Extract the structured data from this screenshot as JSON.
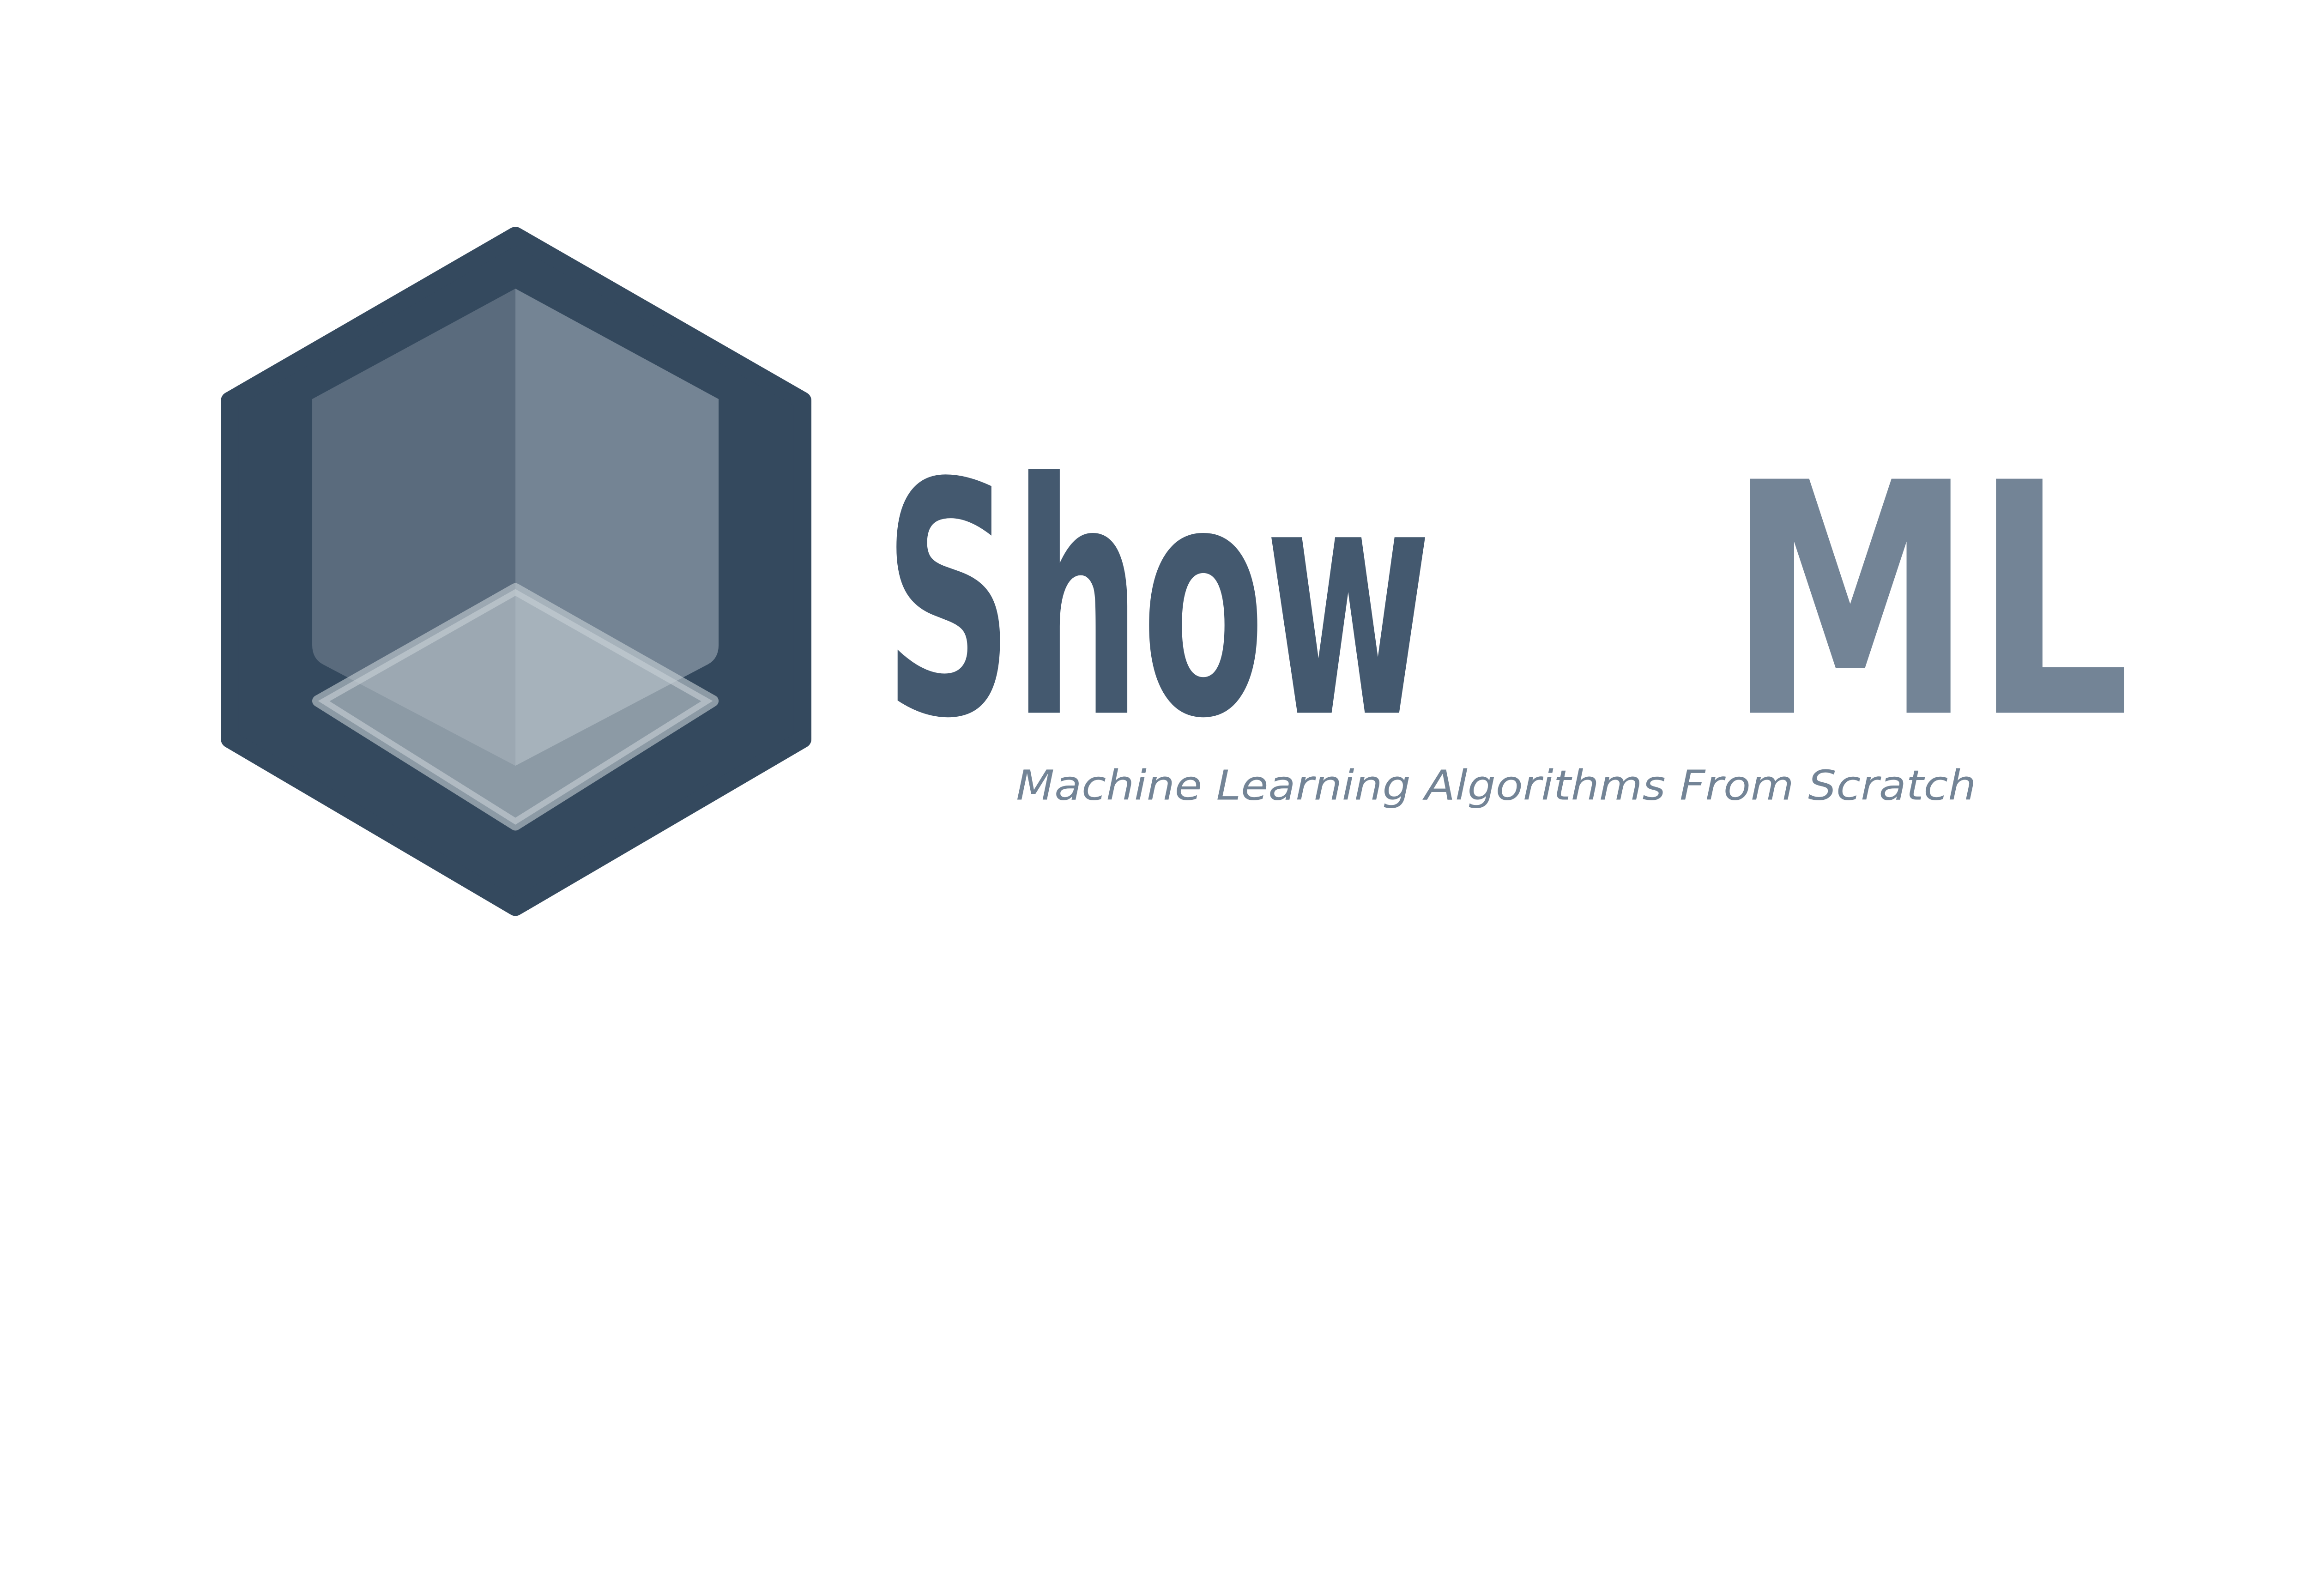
{
  "logo": {
    "name_part1": "Show",
    "name_part2": "ML",
    "tagline": "Machine Learning Algorithms From Scratch",
    "icon": "hexagon-cube-icon"
  },
  "colors": {
    "background": "#ffffff",
    "hexagon": "#34495e",
    "left_face": "#5a6b7d",
    "right_face": "#748494",
    "floor": "#c8d0d6",
    "name_part1": "#44596f",
    "name_part2": "#738496",
    "tagline": "#738496"
  }
}
